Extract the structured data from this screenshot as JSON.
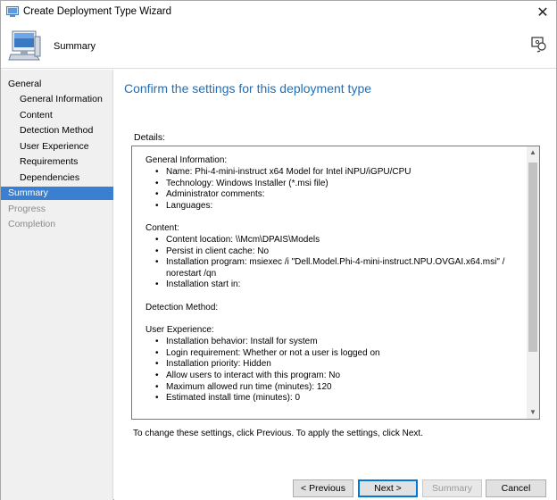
{
  "window": {
    "title": "Create Deployment Type Wizard",
    "close_glyph": "✕"
  },
  "header": {
    "title": "Summary",
    "icon": "computer-icon",
    "help_icon": "help-icon"
  },
  "sidebar": {
    "items": [
      {
        "label": "General",
        "level": 1,
        "state": "normal"
      },
      {
        "label": "General Information",
        "level": 2,
        "state": "normal"
      },
      {
        "label": "Content",
        "level": 2,
        "state": "normal"
      },
      {
        "label": "Detection Method",
        "level": 2,
        "state": "normal"
      },
      {
        "label": "User Experience",
        "level": 2,
        "state": "normal"
      },
      {
        "label": "Requirements",
        "level": 2,
        "state": "normal"
      },
      {
        "label": "Dependencies",
        "level": 2,
        "state": "normal"
      },
      {
        "label": "Summary",
        "level": 1,
        "state": "active"
      },
      {
        "label": "Progress",
        "level": 1,
        "state": "disabled"
      },
      {
        "label": "Completion",
        "level": 1,
        "state": "disabled"
      }
    ]
  },
  "main": {
    "heading": "Confirm the settings for this deployment type",
    "details_label": "Details:",
    "sections": [
      {
        "title": "General Information:",
        "bullets": [
          "Name: Phi-4-mini-instruct x64 Model for Intel iNPU/iGPU/CPU",
          "Technology: Windows Installer (*.msi file)",
          "Administrator comments:",
          "Languages:"
        ]
      },
      {
        "title": "Content:",
        "bullets": [
          "Content location: \\\\Mcm\\DPAIS\\Models",
          "Persist in client cache: No",
          "Installation program: msiexec /i \"Dell.Model.Phi-4-mini-instruct.NPU.OVGAI.x64.msi\" /",
          "norestart /qn",
          "Installation start in:"
        ]
      },
      {
        "title": "Detection Method:",
        "bullets": []
      },
      {
        "title": "User Experience:",
        "bullets": [
          "Installation behavior: Install for system",
          "Login requirement: Whether or not a user is logged on",
          "Installation priority: Hidden",
          "Allow users to interact with this program: No",
          "Maximum allowed run time (minutes): 120",
          "Estimated install time (minutes): 0"
        ]
      }
    ],
    "footer_note": "To change these settings, click Previous. To apply the settings, click Next."
  },
  "buttons": {
    "previous": "< Previous",
    "next": "Next >",
    "summary": "Summary",
    "cancel": "Cancel"
  },
  "scrollbar": {
    "up_glyph": "▲",
    "down_glyph": "▼"
  }
}
